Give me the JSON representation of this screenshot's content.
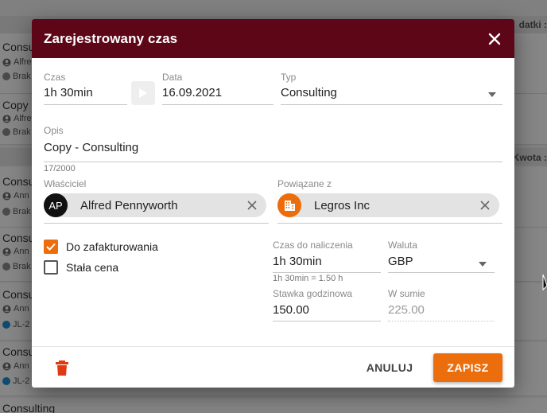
{
  "background": {
    "header_right_top": "datki :",
    "header_right_mid": "Kwota :",
    "rows": [
      {
        "title": "Consulting",
        "line1": "Alfre",
        "line2": "Brak"
      },
      {
        "title": "Copy -",
        "line1": "Alfre",
        "line2": "Brak"
      },
      {
        "title": "Consulting",
        "line1": "Ann",
        "line2": "Brak"
      },
      {
        "title": "Consul",
        "line1": "Ann",
        "line2": "Brak"
      },
      {
        "title": "Consul",
        "line1": "Ann",
        "line2": "JL-2"
      },
      {
        "title": "Consul",
        "line1": "Ann",
        "line2": "JL-2"
      },
      {
        "title": "Consulting",
        "line1": "",
        "line2": ""
      }
    ]
  },
  "dialog": {
    "title": "Zarejestrowany czas",
    "czas": {
      "label": "Czas",
      "value": "1h 30min"
    },
    "data": {
      "label": "Data",
      "value": "16.09.2021"
    },
    "typ": {
      "label": "Typ",
      "value": "Consulting"
    },
    "opis": {
      "label": "Opis",
      "value": "Copy - Consulting",
      "counter": "17/2000"
    },
    "wlasciciel": {
      "label": "Właściciel",
      "initials": "AP",
      "name": "Alfred Pennyworth"
    },
    "powiazane": {
      "label": "Powiązane z",
      "name": "Legros Inc"
    },
    "checkboxes": {
      "do_zafakturowania": {
        "label": "Do zafakturowania",
        "checked": true
      },
      "stala_cena": {
        "label": "Stała cena",
        "checked": false
      }
    },
    "czas_do_naliczenia": {
      "label": "Czas do naliczenia",
      "value": "1h 30min",
      "hint": "1h 30min = 1.50 h"
    },
    "waluta": {
      "label": "Waluta",
      "value": "GBP"
    },
    "stawka": {
      "label": "Stawka godzinowa",
      "value": "150.00"
    },
    "w_sumie": {
      "label": "W sumie",
      "value": "225.00"
    },
    "buttons": {
      "cancel": "ANULUJ",
      "save": "ZAPISZ"
    }
  },
  "colors": {
    "header": "#5d0618",
    "accent": "#ec6d0b"
  }
}
